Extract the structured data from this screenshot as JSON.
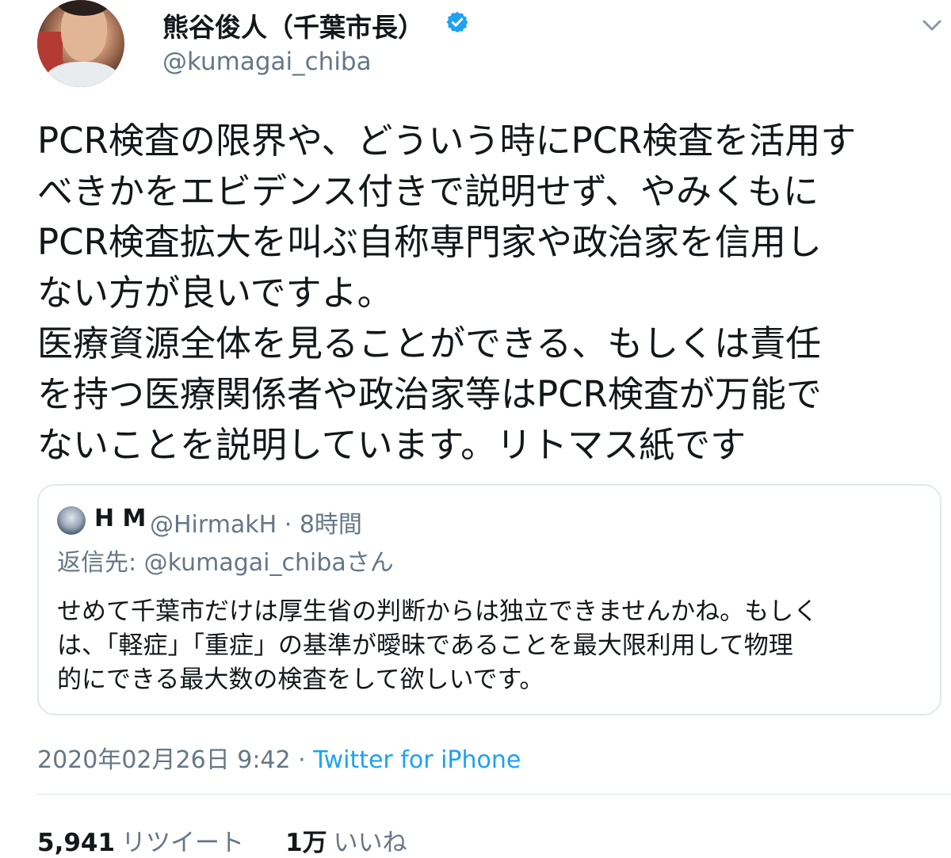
{
  "author": {
    "display_name": "熊谷俊人（千葉市長）",
    "handle": "@kumagai_chiba",
    "verified": true
  },
  "tweet": {
    "text": "PCR検査の限界や、どういう時にPCR検査を活用す\nべきかをエビデンス付きで説明せず、やみくもに\nPCR検査拡大を叫ぶ自称専門家や政治家を信用し\nない方が良いですよ。\n医療資源全体を見ることができる、もしくは責任\nを持つ医療関係者や政治家等はPCR検査が万能で\nないことを説明しています。リトマス紙です",
    "timestamp": "2020年02月26日 9:42",
    "separator": " · ",
    "source": "Twitter for iPhone"
  },
  "quoted_tweet": {
    "name": "H M",
    "meta": "@HirmakH · 8時間",
    "reply_to": "返信先: @kumagai_chibaさん",
    "text": "せめて千葉市だけは厚生省の判断からは独立できませんかね。もしく\nは、「軽症」「重症」の基準が曖昧であることを最大限利用して物理\n的にできる最大数の検査をして欲しいです。"
  },
  "stats": {
    "retweets_count": "5,941",
    "retweets_label": "リツイート",
    "likes_count": "1万",
    "likes_label": "いいね"
  },
  "colors": {
    "text": "#14171a",
    "secondary": "#657786",
    "accent": "#1da1f2",
    "border": "#e1e8ed"
  },
  "icons": {
    "verified": "verified-badge-icon",
    "more": "chevron-down-icon"
  }
}
